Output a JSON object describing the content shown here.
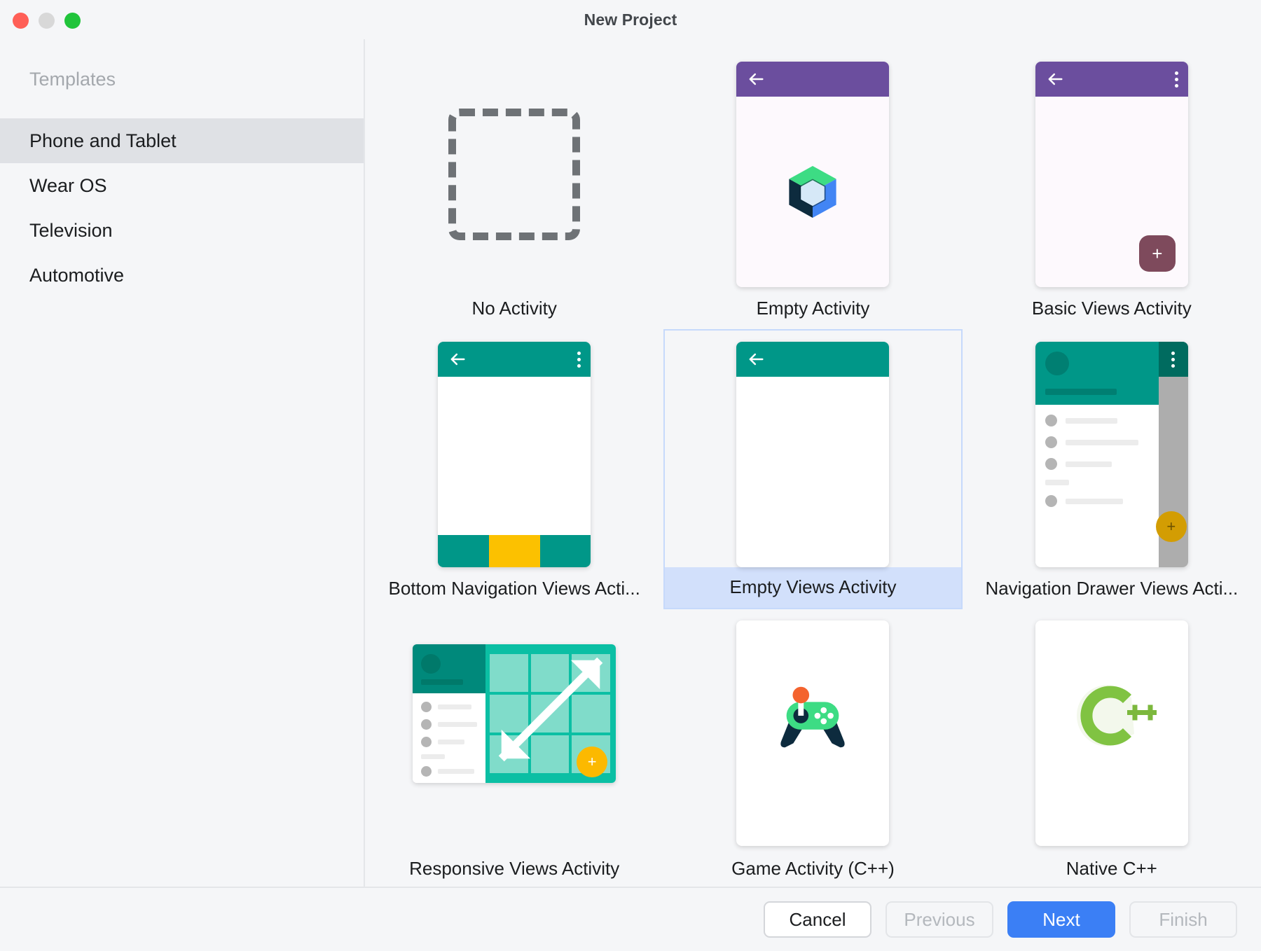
{
  "window": {
    "title": "New Project",
    "traffic_lights": [
      "close-button",
      "minimize-button",
      "maximize-button"
    ]
  },
  "sidebar": {
    "header": "Templates",
    "items": [
      {
        "label": "Phone and Tablet",
        "selected": true
      },
      {
        "label": "Wear OS",
        "selected": false
      },
      {
        "label": "Television",
        "selected": false
      },
      {
        "label": "Automotive",
        "selected": false
      }
    ]
  },
  "templates": [
    {
      "label": "No Activity",
      "selected": false,
      "thumb": "dashed-placeholder"
    },
    {
      "label": "Empty Activity",
      "selected": false,
      "thumb": "compose-logo-phone"
    },
    {
      "label": "Basic Views Activity",
      "selected": false,
      "thumb": "purple-appbar-fab-phone"
    },
    {
      "label": "Bottom Navigation Views Acti...",
      "selected": false,
      "thumb": "teal-appbar-bottomnav-phone"
    },
    {
      "label": "Empty Views Activity",
      "selected": true,
      "thumb": "teal-appbar-phone"
    },
    {
      "label": "Navigation Drawer Views Acti...",
      "selected": false,
      "thumb": "nav-drawer-phone"
    },
    {
      "label": "Responsive Views Activity",
      "selected": false,
      "thumb": "adaptive-grid"
    },
    {
      "label": "Game Activity (C++)",
      "selected": false,
      "thumb": "game-controller"
    },
    {
      "label": "Native C++",
      "selected": false,
      "thumb": "cpp-logo"
    }
  ],
  "footer": {
    "cancel": "Cancel",
    "previous": "Previous",
    "next": "Next",
    "finish": "Finish"
  },
  "colors": {
    "accent_blue": "#3b7ff5",
    "selection_blue": "#d2e0fb",
    "sidebar_selection": "#dfe1e5",
    "teal": "#009788",
    "purple": "#6b4e9e",
    "amber": "#fcc100",
    "compose_green": "#3ddc84",
    "compose_blue": "#4285f4",
    "compose_navy": "#0d2b3e",
    "cpp_green": "#80c342",
    "background": "#f5f6f8"
  }
}
